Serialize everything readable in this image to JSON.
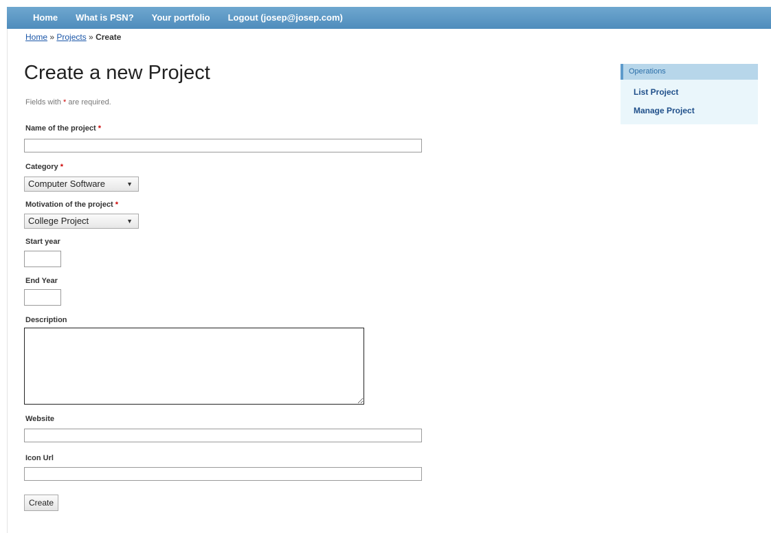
{
  "nav": {
    "items": [
      "Home",
      "What is PSN?",
      "Your portfolio",
      "Logout (josep@josep.com)"
    ]
  },
  "breadcrumb": {
    "home": "Home",
    "separator1": " » ",
    "projects": "Projects",
    "separator2": " » ",
    "current": "Create"
  },
  "page": {
    "title": "Create a new Project",
    "note_prefix": "Fields with ",
    "note_star": "*",
    "note_suffix": " are required."
  },
  "form": {
    "name_label": "Name of the project",
    "required_mark": "*",
    "name_value": "",
    "category_label": "Category",
    "category_value": "Computer Software",
    "motivation_label": "Motivation of the project",
    "motivation_value": "College Project",
    "start_year_label": "Start year",
    "start_year_value": "",
    "end_year_label": "End Year",
    "end_year_value": "",
    "description_label": "Description",
    "website_label": "Website",
    "website_value": "",
    "icon_url_label": "Icon Url",
    "icon_url_value": "",
    "submit_label": "Create",
    "select_arrow": "▼"
  },
  "sidebar": {
    "heading": "Operations",
    "items": [
      "List Project",
      "Manage Project"
    ]
  },
  "colors": {
    "nav_bar": "#5b96c4",
    "link": "#1a56a8",
    "required": "#cc0000",
    "sidebar_bg": "#eaf6fb"
  }
}
